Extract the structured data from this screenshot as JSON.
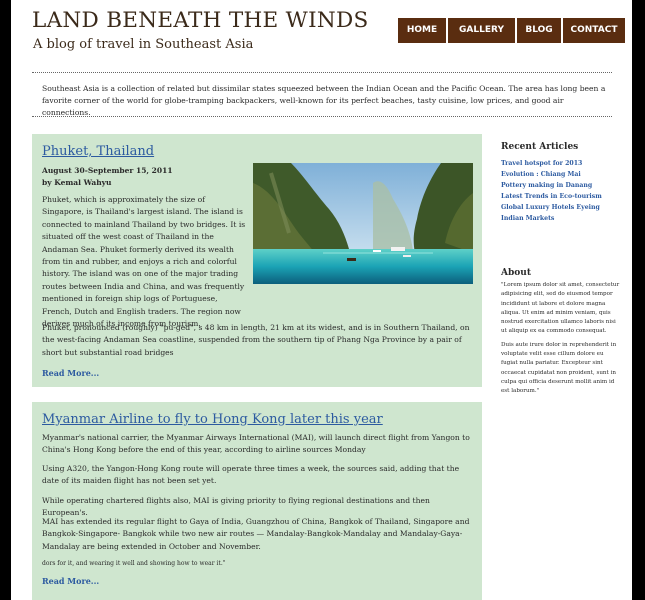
{
  "header": {
    "title": "LAND BENEATH THE WINDS",
    "tagline": "A blog of travel in Southeast Asia"
  },
  "nav": {
    "home": "HOME",
    "gallery": "GALLERY",
    "blog": "BLOG",
    "contact": "CONTACT",
    "bg_color": "#5a2d10"
  },
  "intro": "Southeast Asia is a collection of related but dissimilar states squeezed between the Indian Ocean and the Pacific Ocean. The area has long been a favorite corner of the world for globe-tramping backpackers, well-known for its perfect beaches, tasty cuisine, low prices, and good air connections.",
  "posts": [
    {
      "title": "Phuket, Thailand",
      "date": "August 30-September 15, 2011",
      "author": "by Kemal Wahyu",
      "p1": "Phuket, which is approximately the size of Singapore, is Thailand's largest island. The island is connected to mainland Thailand by two bridges. It is situated off the west coast of Thailand in the Andaman Sea. Phuket formerly derived its wealth from tin and rubber, and enjoys a rich and colorful history. The island was on one of the major trading routes between India and China, and was frequently mentioned in foreign ship logs of Portuguese, French, Dutch and English traders. The region now derives much of its income from tourism.",
      "p2": "Phuket, pronounced (roughly) \"pu-ged\", s 48 km in length, 21 km at its widest, and is in Southern Thailand, on the west-facing Andaman Sea coastline, suspended from the southern tip of Phang Nga Province by a pair of short but substantial road bridges",
      "read_more": "Read More..."
    },
    {
      "title": "Myanmar Airline to fly to Hong Kong later this year",
      "p1": "Myanmar's national carrier, the Myanmar Airways International (MAI), will launch direct flight from Yangon to China's Hong Kong before the end of this year, according to airline sources Monday",
      "p2": "Using A320, the Yangon-Hong Kong route will operate three times a week, the sources said, adding that the date of its maiden flight has not been set yet.",
      "p3": "While operating chartered flights also, MAI is giving priority to flying regional destinations and then European's.",
      "p4": "MAI has extended its regular flight to Gaya of India, Guangzhou of China, Bangkok of Thailand, Singapore and Bangkok-Singapore- Bangkok while two new air routes — Mandalay-Bangkok-Mandalay and Mandalay-Gaya-Mandalay are being extended in October and November.",
      "p5": "dors for it, and wearing it well and showing how to wear it.\"",
      "read_more": "Read More..."
    }
  ],
  "sidebar": {
    "recent_heading": "Recent Articles",
    "recent": [
      "Travel hotspot for 2013",
      "Evolution : Chiang Mai",
      "Pottery making in Danang",
      "Latest Trends in Eco-tourism",
      "Global Luxury Hotels Eyeing Indian Markets"
    ],
    "about_heading": "About",
    "about_p1": "\"Lorem ipsum dolor sit amet, consectetur adipisicing elit, sed do eiusmod tempor incididunt ut labore et dolore magna aliqua. Ut enim ad minim veniam, quis nostrud exercitation ullamco laboris nisi ut aliquip ex ea commodo consequat.",
    "about_p2": "Duis aute irure dolor in reprehenderit in voluptate velit esse cillum dolore eu fugiat nulla pariatur. Excepteur sint occaecat cupidatat non proident, sunt in culpa qui officia deserunt mollit anim id est laborum.\""
  },
  "colors": {
    "post_bg": "#cfe6cf",
    "link": "#2c5aa0",
    "title_brown": "#3b2a1a"
  }
}
